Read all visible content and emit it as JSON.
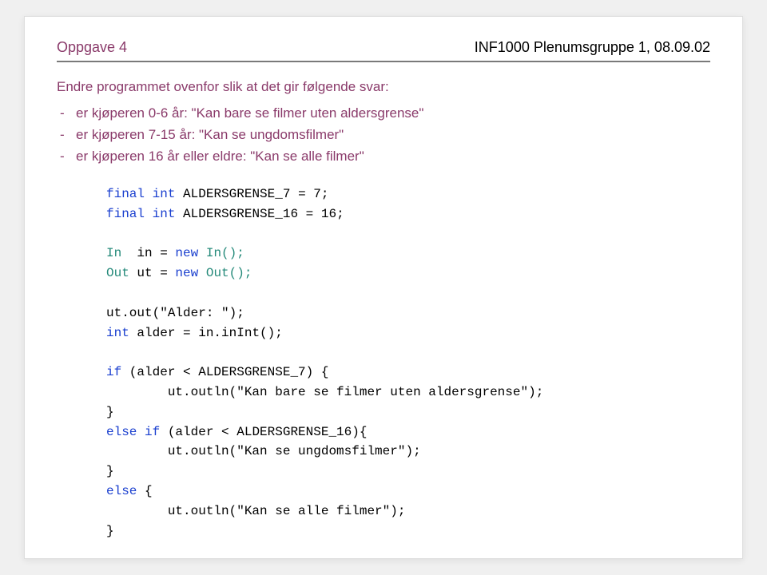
{
  "header": {
    "left": "Oppgave 4",
    "right": "INF1000 Plenumsgruppe 1, 08.09.02"
  },
  "intro": "Endre programmet ovenfor slik at det gir følgende svar:",
  "bullets": [
    "er kjøperen 0-6 år: \"Kan bare se filmer uten aldersgrense\"",
    "er kjøperen 7-15 år: \"Kan se ungdomsfilmer\"",
    "er kjøperen 16 år eller eldre: \"Kan se alle filmer\""
  ],
  "code": {
    "kw_final1": "final",
    "kw_int1": "int",
    "line1_rest": " ALDERSGRENSE_7 = 7;",
    "kw_final2": "final",
    "kw_int2": "int",
    "line2_rest": " ALDERSGRENSE_16 = 16;",
    "tn_In": "In",
    "line3_mid": "  in = ",
    "kw_new1": "new",
    "tn_InCall": " In();",
    "tn_Out": "Out",
    "line4_mid": " ut = ",
    "kw_new2": "new",
    "tn_OutCall": " Out();",
    "line5": "ut.out(\"Alder: \");",
    "kw_int3": "int",
    "line6_rest": " alder = in.inInt();",
    "kw_if1": "if",
    "line7_rest": " (alder < ALDERSGRENSE_7) {",
    "line8": "        ut.outln(\"Kan bare se filmer uten aldersgrense\");",
    "line9": "}",
    "kw_else1": "else",
    "kw_if2": " if",
    "line10_rest": " (alder < ALDERSGRENSE_16){",
    "line11": "        ut.outln(\"Kan se ungdomsfilmer\");",
    "line12": "}",
    "kw_else2": "else",
    "line13_rest": " {",
    "line14": "        ut.outln(\"Kan se alle filmer\");",
    "line15": "}"
  }
}
